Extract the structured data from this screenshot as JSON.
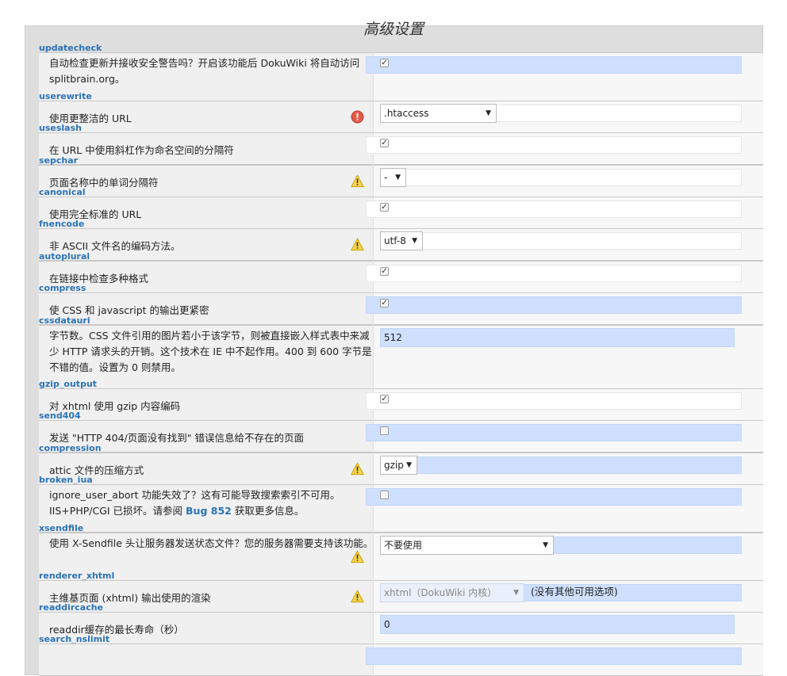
{
  "title": "高级设置",
  "rows": [
    {
      "key": "updatecheck",
      "label": "自动检查更新并接收安全警告吗？开启该功能后 DokuWiki 将自动访问 splitbrain.org。",
      "control": "checkbox",
      "checked": true,
      "box": "blue",
      "icon": null
    },
    {
      "key": "userewrite",
      "label": "使用更整洁的 URL",
      "control": "select",
      "value": ".htaccess",
      "box": "white",
      "icon": "error-icon"
    },
    {
      "key": "useslash",
      "label": "在 URL 中使用斜杠作为命名空间的分隔符",
      "control": "checkbox",
      "checked": true,
      "box": "white",
      "icon": null
    },
    {
      "key": "sepchar",
      "label": "页面名称中的单词分隔符",
      "control": "select",
      "value": "-",
      "box": "white",
      "icon": "warning-icon"
    },
    {
      "key": "canonical",
      "label": "使用完全标准的 URL",
      "control": "checkbox",
      "checked": true,
      "box": "white",
      "icon": null
    },
    {
      "key": "fnencode",
      "label": "非 ASCII 文件名的编码方法。",
      "control": "select",
      "value": "utf-8",
      "box": "white",
      "icon": "warning-icon"
    },
    {
      "key": "autoplural",
      "label": "在链接中检查多种格式",
      "control": "checkbox",
      "checked": true,
      "box": "white",
      "icon": null
    },
    {
      "key": "compress",
      "label": "使 CSS 和 javascript 的输出更紧密",
      "control": "checkbox",
      "checked": true,
      "box": "blue",
      "icon": null
    },
    {
      "key": "cssdatauri",
      "label": "字节数。CSS 文件引用的图片若小于该字节，则被直接嵌入样式表中来减少 HTTP 请求头的开销。这个技术在 IE 中不起作用。400 到 600 字节是不错的值。设置为 0 则禁用。",
      "control": "text",
      "value": "512",
      "box": "none",
      "icon": null
    },
    {
      "key": "gzip_output",
      "label": "对 xhtml 使用 gzip 内容编码",
      "control": "checkbox",
      "checked": true,
      "box": "white",
      "icon": null
    },
    {
      "key": "send404",
      "label": "发送 \"HTTP 404/页面没有找到\" 错误信息给不存在的页面",
      "control": "checkbox",
      "checked": false,
      "box": "blue",
      "icon": null
    },
    {
      "key": "compression",
      "label": "attic 文件的压缩方式",
      "control": "select",
      "value": "gzip",
      "box": "blue",
      "icon": "warning-icon"
    },
    {
      "key": "broken_iua",
      "label_pre": "ignore_user_abort 功能失效了？这有可能导致搜索索引不可用。IIS+PHP/CGI 已损坏。请参阅 ",
      "label_link": "Bug 852",
      "label_post": " 获取更多信息。",
      "control": "checkbox",
      "checked": false,
      "box": "blue",
      "icon": null
    },
    {
      "key": "xsendfile",
      "label": "使用 X-Sendfile 头让服务器发送状态文件？您的服务器需要支持该功能。",
      "control": "select",
      "value": "不要使用",
      "box": "blue",
      "icon": "warning-icon"
    },
    {
      "key": "renderer_xhtml",
      "label": "主维基页面 (xhtml) 输出使用的渲染",
      "control": "select-disabled",
      "value": "xhtml（DokuWiki 内核）",
      "note": "(没有其他可用选项)",
      "box": "blue",
      "icon": "warning-icon"
    },
    {
      "key": "readdircache",
      "label": "readdir缓存的最长寿命（秒）",
      "control": "text",
      "value": "0",
      "box": "none",
      "icon": null
    },
    {
      "key": "search_nslimit",
      "label": "",
      "control": "none",
      "box": "blue",
      "icon": null
    }
  ]
}
